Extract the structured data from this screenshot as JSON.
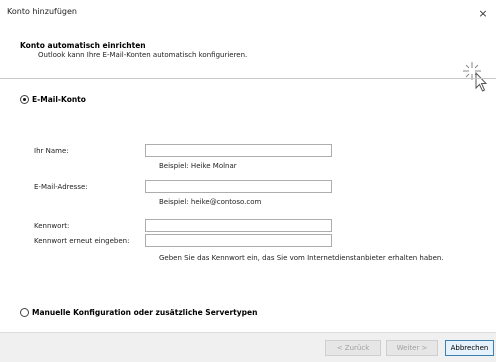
{
  "window": {
    "title": "Konto hinzufügen",
    "close_glyph": "×"
  },
  "header": {
    "title": "Konto automatisch einrichten",
    "subtitle": "Outlook kann Ihre E-Mail-Konten automatisch konfigurieren.",
    "icon": "cursor-sparkle-icon"
  },
  "options": {
    "email_account": {
      "label": "E-Mail-Konto",
      "selected": true
    },
    "manual_config": {
      "label": "Manuelle Konfiguration oder zusätzliche Servertypen",
      "selected": false
    }
  },
  "form": {
    "name": {
      "label": "Ihr Name:",
      "value": "",
      "hint": "Beispiel: Heike Molnar"
    },
    "email": {
      "label": "E-Mail-Adresse:",
      "value": "",
      "hint": "Beispiel: heike@contoso.com"
    },
    "password": {
      "label": "Kennwort:",
      "value": ""
    },
    "password_confirm": {
      "label": "Kennwort erneut eingeben:",
      "value": "",
      "hint": "Geben Sie das Kennwort ein, das Sie vom Internetdienstanbieter erhalten haben."
    }
  },
  "buttons": {
    "back": {
      "label": "< Zurück",
      "enabled": false
    },
    "next": {
      "label": "Weiter >",
      "enabled": false
    },
    "cancel": {
      "label": "Abbrechen",
      "enabled": true
    }
  },
  "colors": {
    "accent": "#3c7fb1",
    "footer_bg": "#f0f0f0",
    "disabled_text": "#a0a0a0"
  }
}
